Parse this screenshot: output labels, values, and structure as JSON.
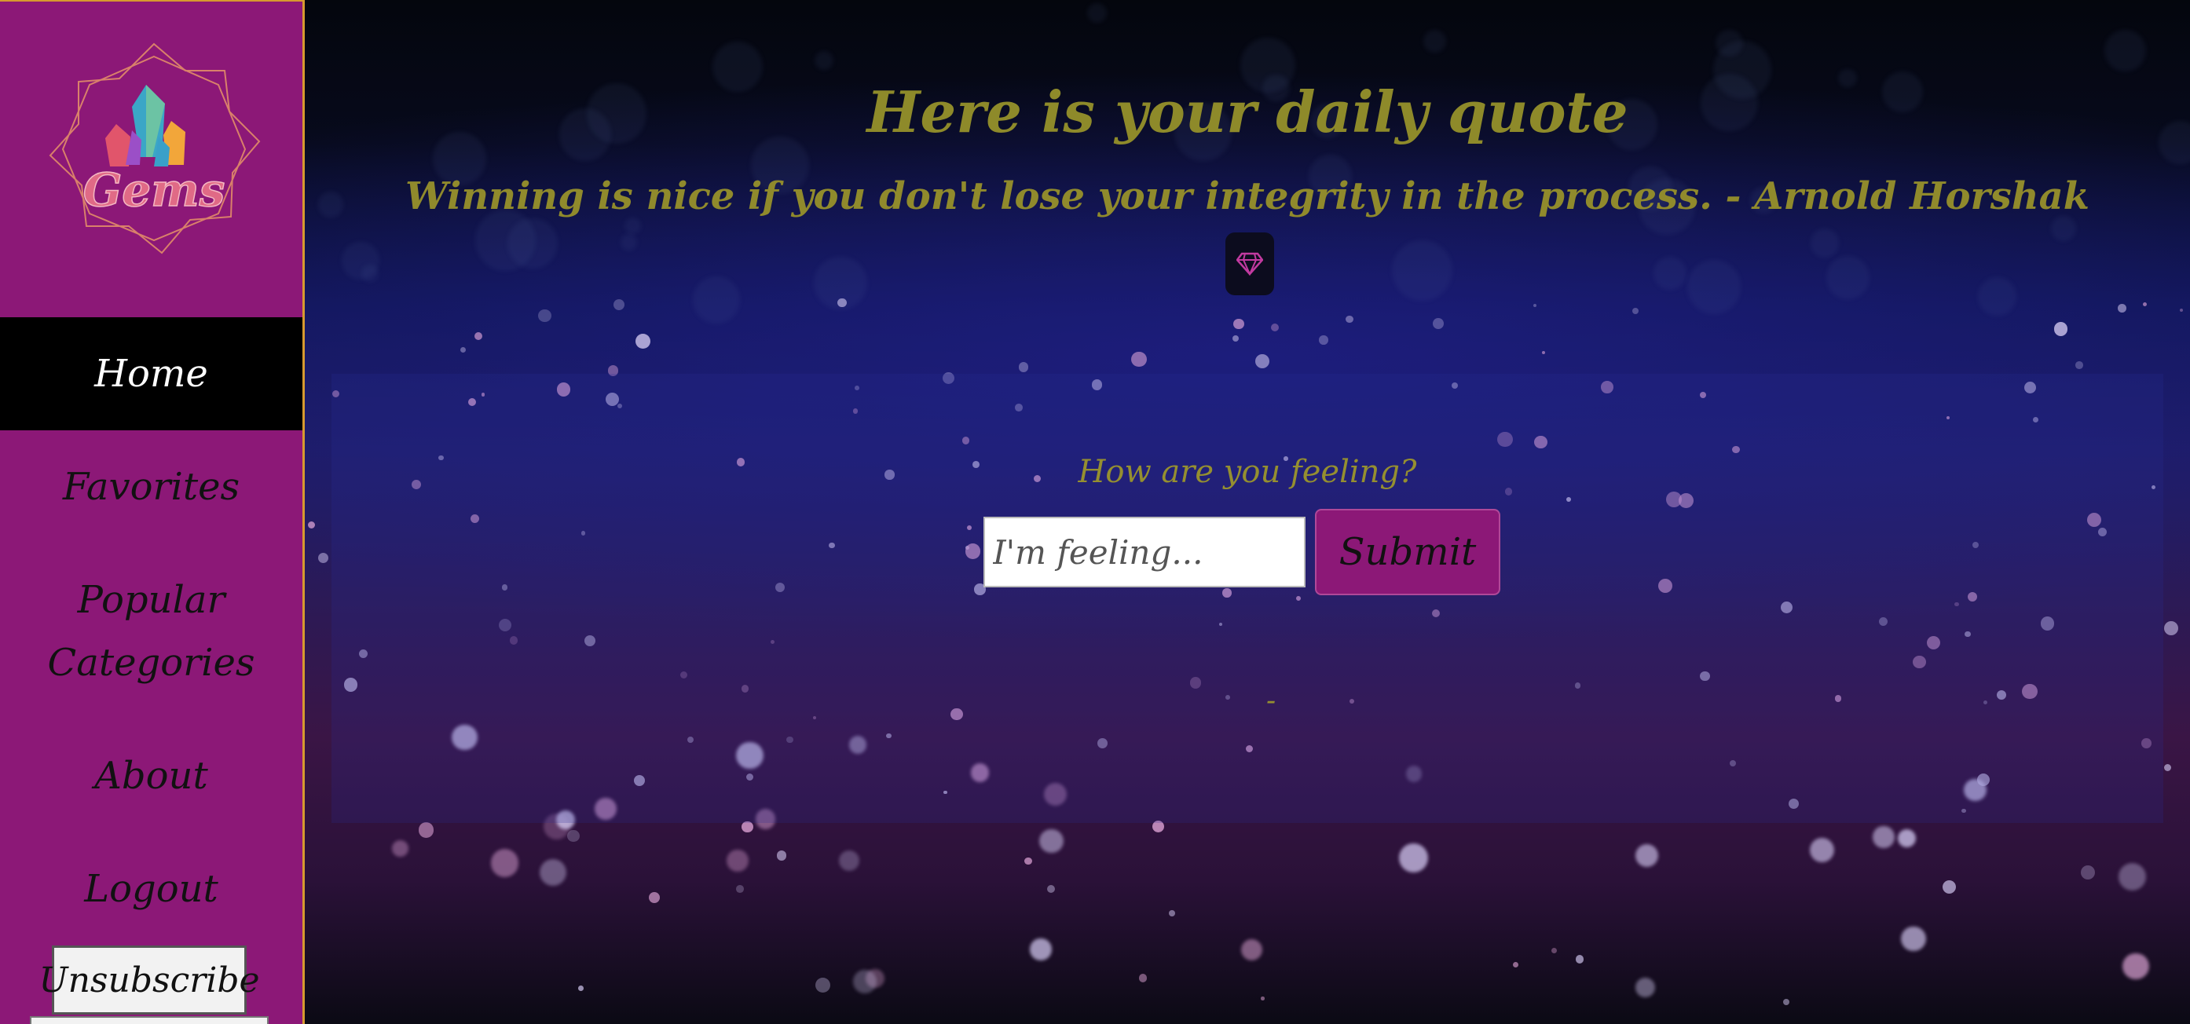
{
  "sidebar": {
    "logo_text": "Gems",
    "nav": {
      "home": "Home",
      "favorites": "Favorites",
      "popular_line1": "Popular",
      "popular_line2": "Categories",
      "about": "About",
      "logout": "Logout"
    },
    "unsubscribe": "Unsubscribe"
  },
  "main": {
    "title": "Here is your daily quote",
    "quote": "Winning is nice if you don't lose your integrity in the process. - Arnold Horshak",
    "gem_icon": "diamond-icon",
    "feeling_label": "How are you feeling?",
    "feeling_placeholder": "I'm feeling...",
    "submit_label": "Submit",
    "result_text": "-"
  },
  "colors": {
    "sidebar_bg": "#8c1877",
    "sidebar_border": "#d79a2f",
    "text_gold": "#908a2c",
    "active_nav_bg": "#000000"
  }
}
